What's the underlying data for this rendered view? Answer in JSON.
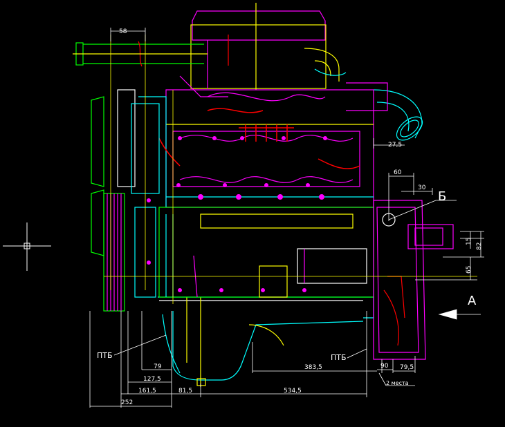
{
  "colors": {
    "background": "#000000",
    "magenta": "#ff00ff",
    "green": "#00ff00",
    "cyan": "#00ffff",
    "yellow": "#ffff00",
    "red": "#ff0000",
    "white": "#ffffff"
  },
  "labels": {
    "view_b": "Б",
    "view_a": "А",
    "ptb_left": "ПТБ",
    "ptb_right": "ПТБ",
    "places": "2 места"
  },
  "dimensions": {
    "d58": "58",
    "d27_5": "27,5",
    "d60": "60",
    "d30": "30",
    "d15": "15",
    "d82": "82",
    "d65": "65",
    "d79": "79",
    "d127_5": "127,5",
    "d161_5": "161,5",
    "d252": "252",
    "d81_5": "81,5",
    "d534_5": "534,5",
    "d383_5": "383,5",
    "d90": "90",
    "d79_5": "79,5"
  }
}
